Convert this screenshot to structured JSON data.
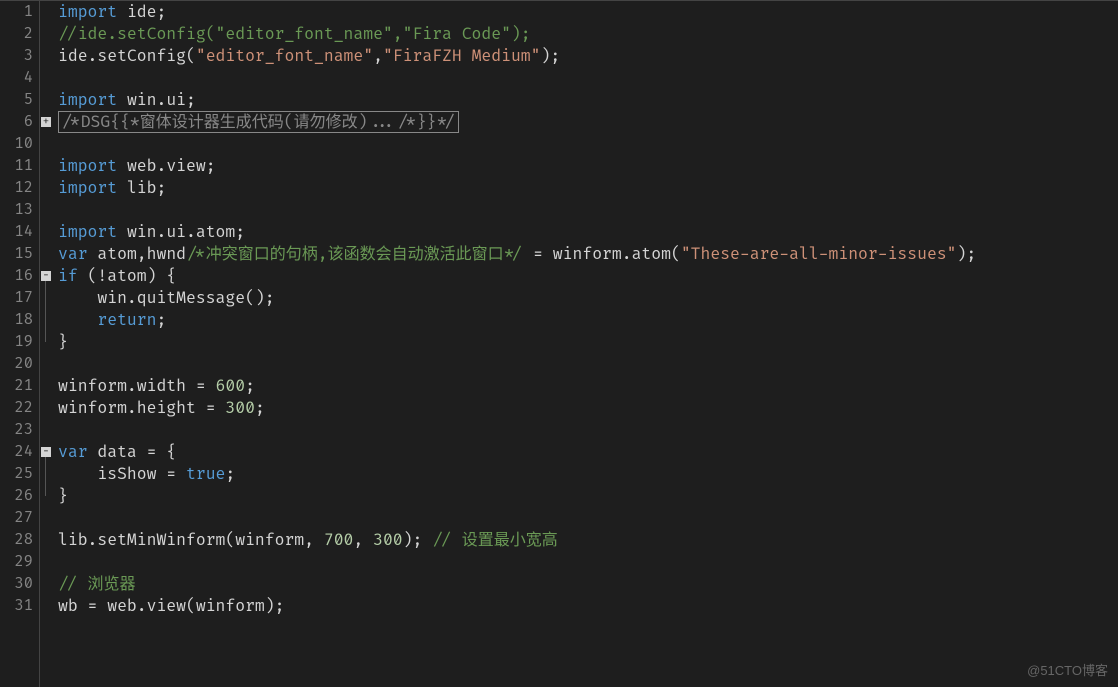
{
  "watermark": "@51CTO博客",
  "lines": [
    {
      "num": "1",
      "tokens": [
        {
          "t": "keyword",
          "v": "import"
        },
        {
          "t": "punct",
          "v": " "
        },
        {
          "t": "ident",
          "v": "ide"
        },
        {
          "t": "punct",
          "v": ";"
        }
      ]
    },
    {
      "num": "2",
      "tokens": [
        {
          "t": "comment",
          "v": "//ide.setConfig(\"editor_font_name\",\"Fira Code\");"
        }
      ]
    },
    {
      "num": "3",
      "tokens": [
        {
          "t": "ident",
          "v": "ide.setConfig("
        },
        {
          "t": "string",
          "v": "\"editor_font_name\""
        },
        {
          "t": "punct",
          "v": ","
        },
        {
          "t": "string",
          "v": "\"FiraFZH Medium\""
        },
        {
          "t": "punct",
          "v": ");"
        }
      ]
    },
    {
      "num": "4",
      "tokens": []
    },
    {
      "num": "5",
      "tokens": [
        {
          "t": "keyword",
          "v": "import"
        },
        {
          "t": "punct",
          "v": " "
        },
        {
          "t": "ident",
          "v": "win.ui"
        },
        {
          "t": "punct",
          "v": ";"
        }
      ]
    },
    {
      "num": "6",
      "fold": "plus",
      "folded": true,
      "tokens": [
        {
          "t": "folded",
          "v": "/*DSG{{*窗体设计器生成代码(请勿修改).../*}}*/"
        }
      ]
    },
    {
      "num": "10",
      "tokens": []
    },
    {
      "num": "11",
      "tokens": [
        {
          "t": "keyword",
          "v": "import"
        },
        {
          "t": "punct",
          "v": " "
        },
        {
          "t": "ident",
          "v": "web.view"
        },
        {
          "t": "punct",
          "v": ";"
        }
      ]
    },
    {
      "num": "12",
      "tokens": [
        {
          "t": "keyword",
          "v": "import"
        },
        {
          "t": "punct",
          "v": " "
        },
        {
          "t": "ident",
          "v": "lib"
        },
        {
          "t": "punct",
          "v": ";"
        }
      ]
    },
    {
      "num": "13",
      "tokens": []
    },
    {
      "num": "14",
      "tokens": [
        {
          "t": "keyword",
          "v": "import"
        },
        {
          "t": "punct",
          "v": " "
        },
        {
          "t": "ident",
          "v": "win.ui.atom"
        },
        {
          "t": "punct",
          "v": ";"
        }
      ]
    },
    {
      "num": "15",
      "tokens": [
        {
          "t": "keyword",
          "v": "var"
        },
        {
          "t": "punct",
          "v": " "
        },
        {
          "t": "ident",
          "v": "atom,hwnd"
        },
        {
          "t": "comment",
          "v": "/*冲突窗口的句柄,该函数会自动激活此窗口*/"
        },
        {
          "t": "punct",
          "v": " = winform.atom("
        },
        {
          "t": "string",
          "v": "\"These-are-all-minor-issues\""
        },
        {
          "t": "punct",
          "v": ");"
        }
      ]
    },
    {
      "num": "16",
      "fold": "minus",
      "tokens": [
        {
          "t": "keyword",
          "v": "if"
        },
        {
          "t": "punct",
          "v": " (!atom) {"
        }
      ]
    },
    {
      "num": "17",
      "tokens": [
        {
          "t": "punct",
          "v": "    "
        },
        {
          "t": "ident",
          "v": "win.quitMessage()"
        },
        {
          "t": "punct",
          "v": ";"
        }
      ]
    },
    {
      "num": "18",
      "tokens": [
        {
          "t": "punct",
          "v": "    "
        },
        {
          "t": "keyword",
          "v": "return"
        },
        {
          "t": "punct",
          "v": ";"
        }
      ]
    },
    {
      "num": "19",
      "tokens": [
        {
          "t": "punct",
          "v": "}"
        }
      ]
    },
    {
      "num": "20",
      "tokens": []
    },
    {
      "num": "21",
      "tokens": [
        {
          "t": "ident",
          "v": "winform.width = "
        },
        {
          "t": "number",
          "v": "600"
        },
        {
          "t": "punct",
          "v": ";"
        }
      ]
    },
    {
      "num": "22",
      "tokens": [
        {
          "t": "ident",
          "v": "winform.height = "
        },
        {
          "t": "number",
          "v": "300"
        },
        {
          "t": "punct",
          "v": ";"
        }
      ]
    },
    {
      "num": "23",
      "tokens": []
    },
    {
      "num": "24",
      "fold": "minus",
      "tokens": [
        {
          "t": "keyword",
          "v": "var"
        },
        {
          "t": "punct",
          "v": " data = {"
        }
      ]
    },
    {
      "num": "25",
      "tokens": [
        {
          "t": "punct",
          "v": "    isShow = "
        },
        {
          "t": "bool",
          "v": "true"
        },
        {
          "t": "punct",
          "v": ";"
        }
      ]
    },
    {
      "num": "26",
      "tokens": [
        {
          "t": "punct",
          "v": "}"
        }
      ]
    },
    {
      "num": "27",
      "tokens": []
    },
    {
      "num": "28",
      "tokens": [
        {
          "t": "ident",
          "v": "lib.setMinWinform(winform, "
        },
        {
          "t": "number",
          "v": "700"
        },
        {
          "t": "punct",
          "v": ", "
        },
        {
          "t": "number",
          "v": "300"
        },
        {
          "t": "punct",
          "v": "); "
        },
        {
          "t": "comment",
          "v": "// 设置最小宽高"
        }
      ]
    },
    {
      "num": "29",
      "tokens": []
    },
    {
      "num": "30",
      "tokens": [
        {
          "t": "comment",
          "v": "// 浏览器"
        }
      ]
    },
    {
      "num": "31",
      "tokens": [
        {
          "t": "ident",
          "v": "wb = web.view(winform)"
        },
        {
          "t": "punct",
          "v": ";"
        }
      ]
    }
  ],
  "foldLines": [
    {
      "start": 16,
      "end": 19
    },
    {
      "start": 24,
      "end": 26
    }
  ]
}
